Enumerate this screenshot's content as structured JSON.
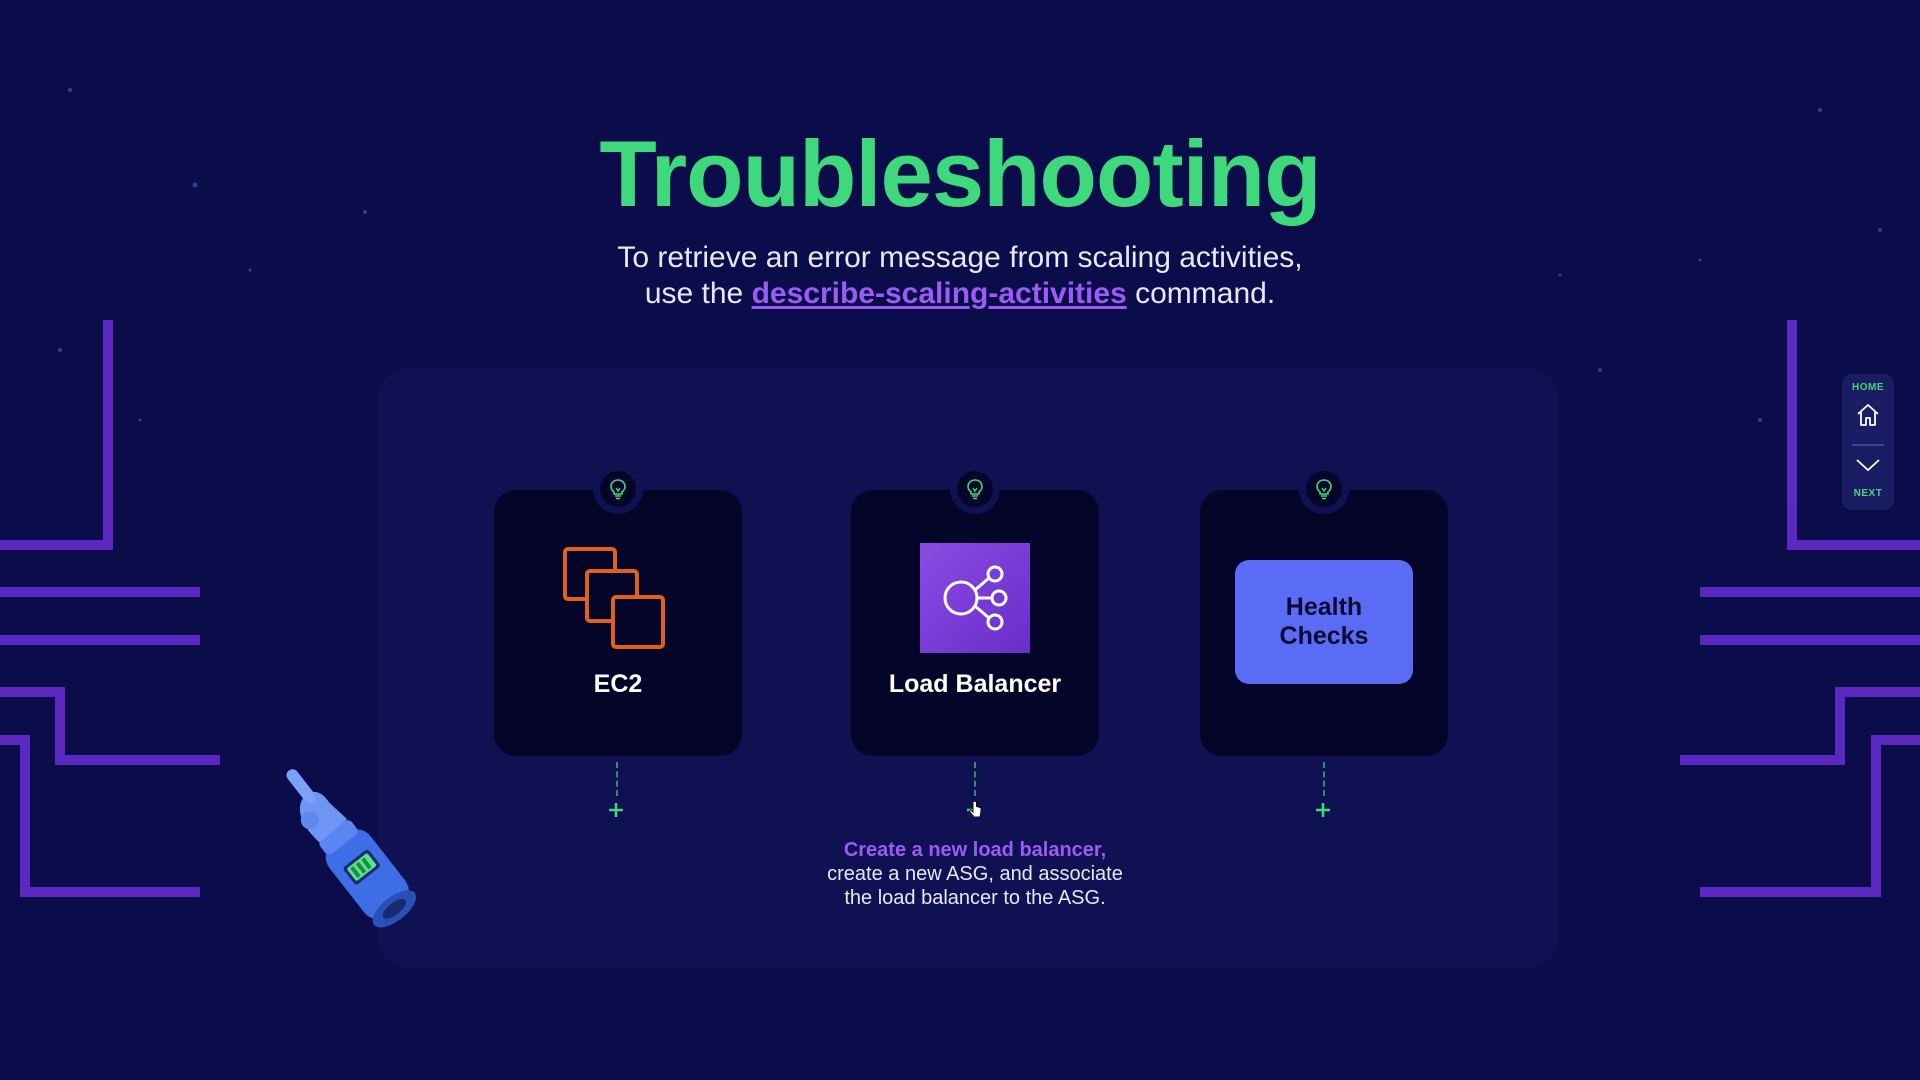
{
  "title": "Troubleshooting",
  "subtitle": {
    "line1": "To retrieve an error message from scaling activities,",
    "prefix": "use the",
    "command": "describe-scaling-activities",
    "suffix": "command."
  },
  "cards": [
    {
      "label": "EC2",
      "icon": "ec2-instances-icon"
    },
    {
      "label": "Load Balancer",
      "icon": "elastic-load-balancing-icon"
    },
    {
      "label": "Health\nChecks",
      "icon": "none"
    }
  ],
  "detail": {
    "highlight": "Create a new load balancer,",
    "line2": "create a new ASG, and associate",
    "line3": "the load balancer to the ASG."
  },
  "nav": {
    "home_label": "HOME",
    "next_label": "NEXT"
  },
  "colors": {
    "background": "#0b0c4a",
    "panel": "#0f1152",
    "card": "#05052a",
    "accent_green": "#3ed97c",
    "accent_purple": "#9b5cf5",
    "ec2_orange": "#e0611e",
    "health_blue": "#5a6cf5"
  }
}
